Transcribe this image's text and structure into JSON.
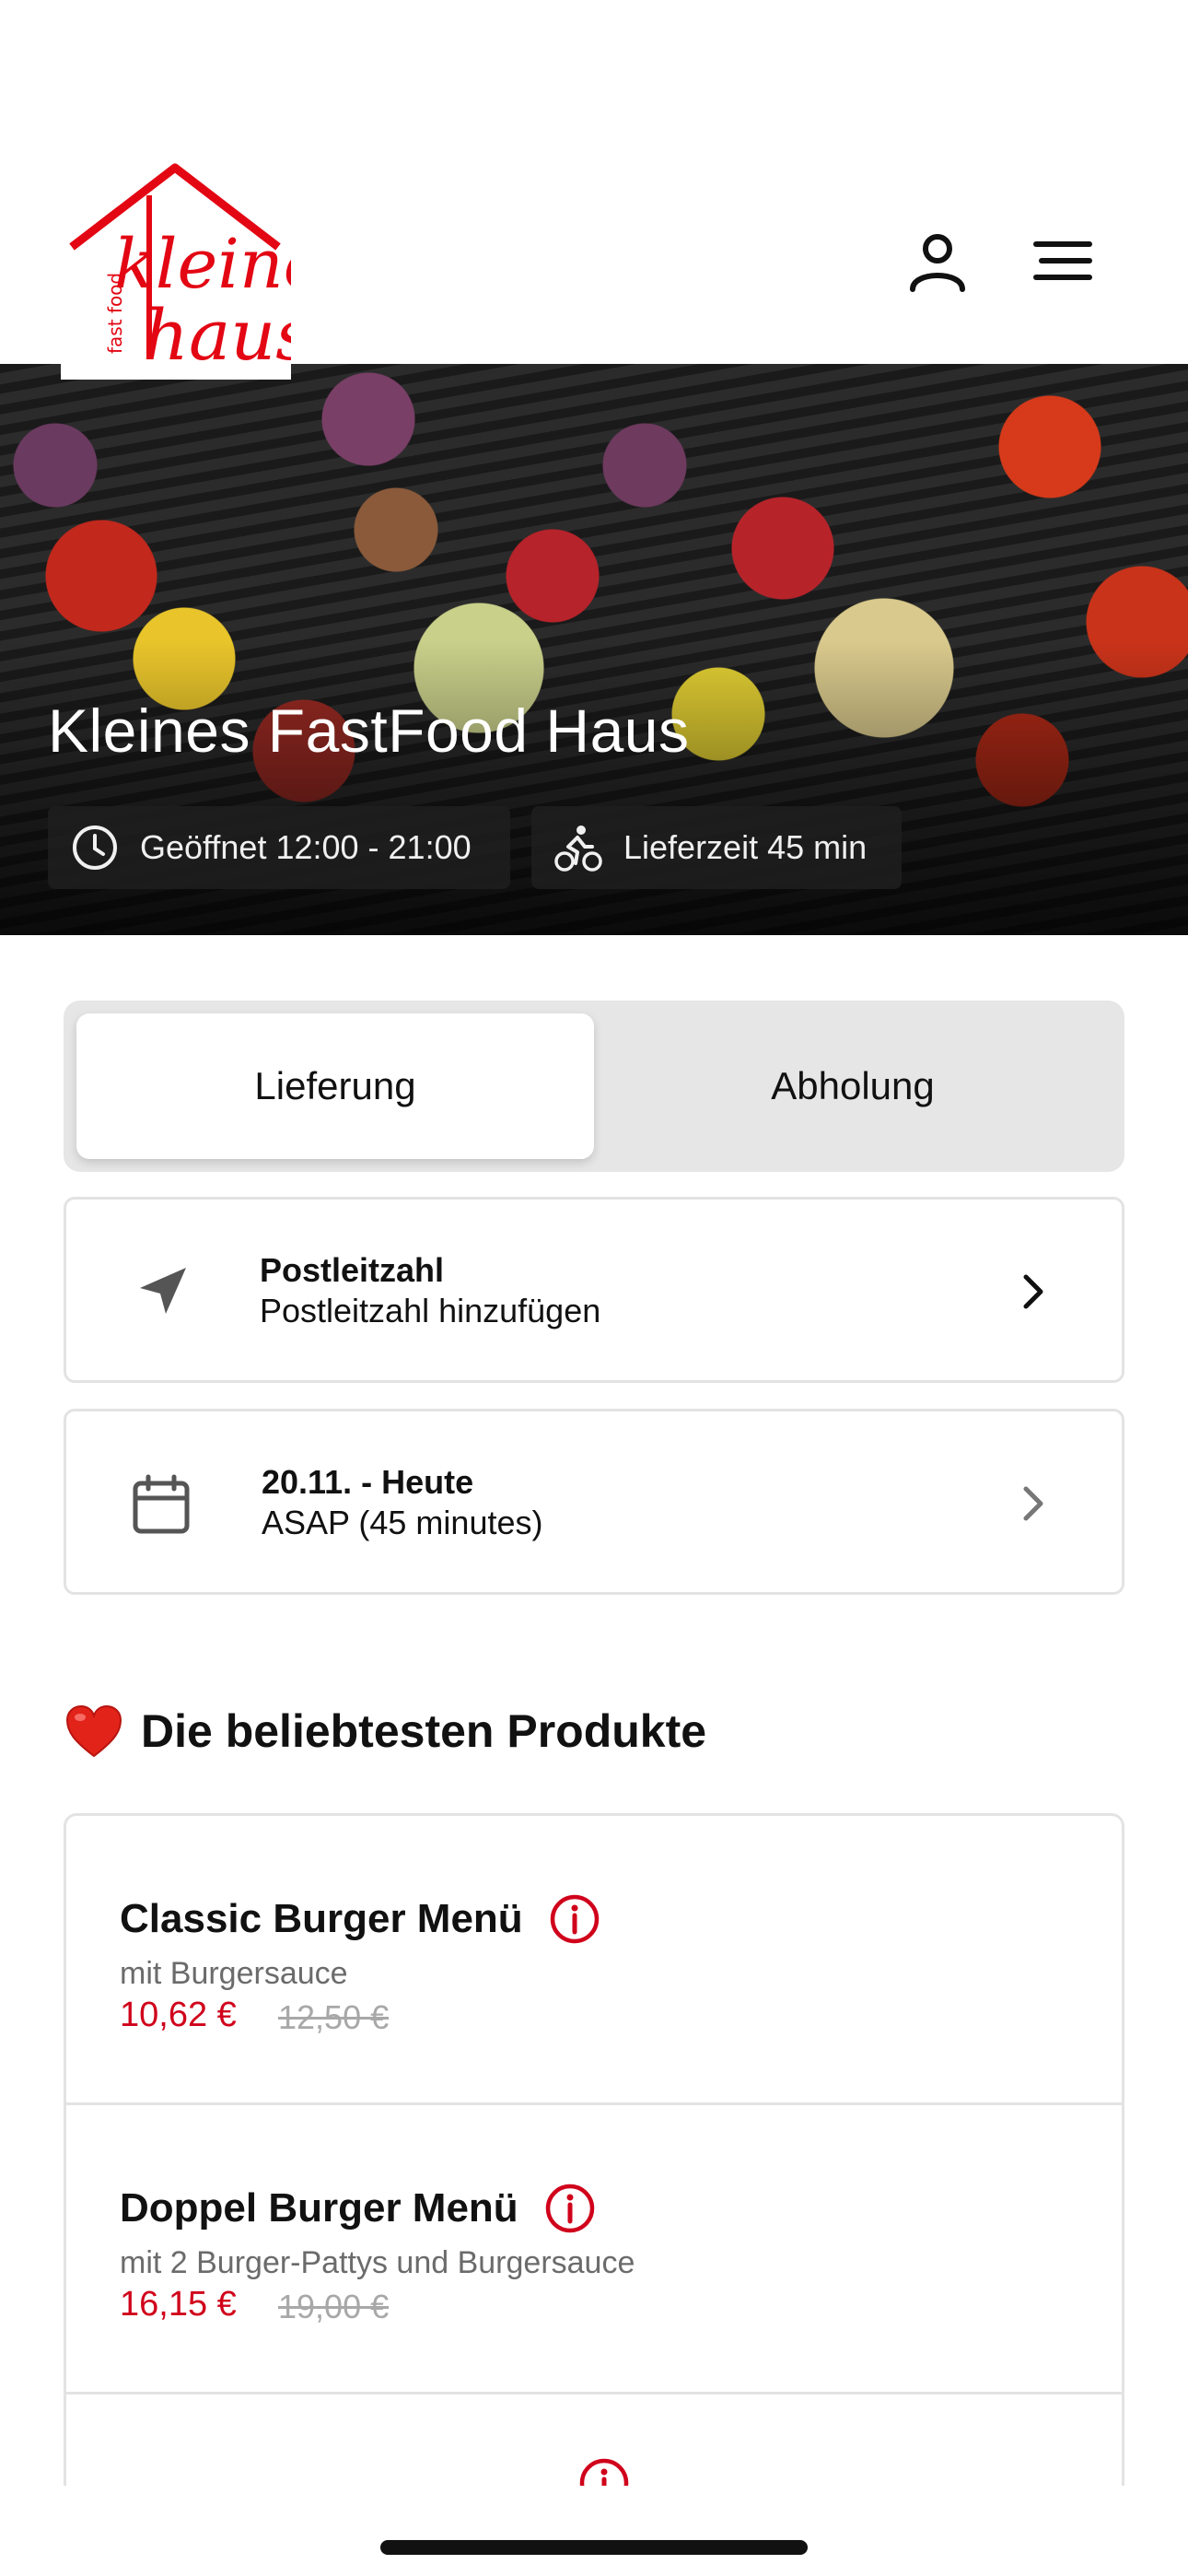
{
  "header": {
    "logo": {
      "text_top": "kleines",
      "text_bottom": "haus",
      "text_side": "fast food",
      "color": "#e30613"
    },
    "account_icon": "user-icon",
    "menu_icon": "hamburger-menu-icon"
  },
  "hero": {
    "title": "Kleines FastFood Haus",
    "chips": [
      {
        "icon": "clock-icon",
        "label": "Geöffnet 12:00 - 21:00"
      },
      {
        "icon": "delivery-bike-icon",
        "label": "Lieferzeit 45 min"
      }
    ]
  },
  "order_mode": {
    "options": [
      "Lieferung",
      "Abholung"
    ],
    "selected": "Lieferung"
  },
  "location_card": {
    "icon": "location-arrow-icon",
    "title": "Postleitzahl",
    "subtitle": "Postleitzahl hinzufügen"
  },
  "time_card": {
    "icon": "calendar-icon",
    "title": "20.11. - Heute",
    "subtitle": "ASAP (45 minutes)"
  },
  "popular": {
    "title": "Die beliebtesten Produkte",
    "icon": "heart-icon",
    "products": [
      {
        "name": "Classic Burger Menü",
        "description": "mit Burgersauce",
        "price": "10,62 €",
        "old_price": "12,50 €"
      },
      {
        "name": "Doppel Burger Menü",
        "description": "mit 2 Burger-Pattys und Burgersauce",
        "price": "16,15 €",
        "old_price": "19,00 €"
      }
    ]
  },
  "colors": {
    "accent": "#d0021b",
    "card_border": "#e3e3e3",
    "toggle_bg": "#e6e6e6"
  }
}
